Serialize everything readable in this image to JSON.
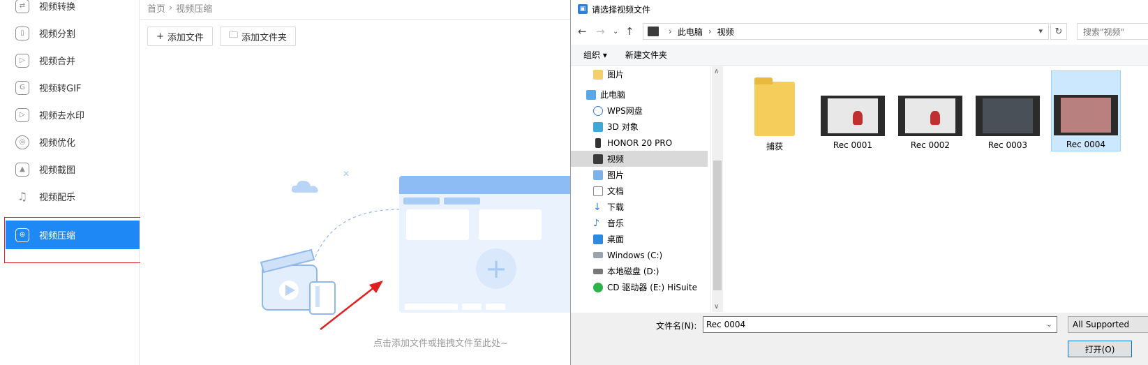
{
  "sidebar": {
    "items": [
      {
        "label": "视频转换",
        "icon": "convert-icon"
      },
      {
        "label": "视频分割",
        "icon": "split-icon"
      },
      {
        "label": "视频合并",
        "icon": "merge-icon"
      },
      {
        "label": "视频转GIF",
        "icon": "gif-icon"
      },
      {
        "label": "视频去水印",
        "icon": "watermark-icon"
      },
      {
        "label": "视频优化",
        "icon": "optimize-icon"
      },
      {
        "label": "视频截图",
        "icon": "screenshot-icon"
      },
      {
        "label": "视频配乐",
        "icon": "music-icon"
      },
      {
        "label": "视频压缩",
        "icon": "compress-icon"
      }
    ],
    "active_index": 8,
    "active_color": "#1e88f5"
  },
  "main": {
    "breadcrumb": {
      "home": "首页",
      "sep": "›",
      "current": "视频压缩"
    },
    "add_file_label": "添加文件",
    "add_folder_label": "添加文件夹",
    "hint": "点击添加文件或拖拽文件至此处~"
  },
  "dialog": {
    "title": "请选择视频文件",
    "address": {
      "root": "此电脑",
      "folder": "视频",
      "sep": "›"
    },
    "search_placeholder": "搜索\"视频\"",
    "toolbar": {
      "organize": "组织 ▾",
      "new_folder": "新建文件夹"
    },
    "tree": [
      {
        "label": "图片",
        "icon": "pictures-icon",
        "indent": 1
      },
      {
        "label": "此电脑",
        "icon": "this-pc-icon",
        "indent": 0
      },
      {
        "label": "WPS网盘",
        "icon": "cloud-drive-icon",
        "indent": 1
      },
      {
        "label": "3D 对象",
        "icon": "3d-objects-icon",
        "indent": 1
      },
      {
        "label": "HONOR 20 PRO",
        "icon": "phone-icon",
        "indent": 1
      },
      {
        "label": "视频",
        "icon": "videos-icon",
        "indent": 1,
        "selected": true
      },
      {
        "label": "图片",
        "icon": "pictures-icon",
        "indent": 1
      },
      {
        "label": "文档",
        "icon": "documents-icon",
        "indent": 1
      },
      {
        "label": "下载",
        "icon": "downloads-icon",
        "indent": 1
      },
      {
        "label": "音乐",
        "icon": "music-note-icon",
        "indent": 1
      },
      {
        "label": "桌面",
        "icon": "desktop-icon",
        "indent": 1
      },
      {
        "label": "Windows (C:)",
        "icon": "windows-drive-icon",
        "indent": 1
      },
      {
        "label": "本地磁盘 (D:)",
        "icon": "disk-drive-icon",
        "indent": 1
      },
      {
        "label": "CD 驱动器 (E:) HiSuite",
        "icon": "cd-drive-icon",
        "indent": 1
      }
    ],
    "files": [
      {
        "label": "捕获",
        "kind": "folder"
      },
      {
        "label": "Rec 0001",
        "kind": "video"
      },
      {
        "label": "Rec 0002",
        "kind": "video"
      },
      {
        "label": "Rec 0003",
        "kind": "video"
      },
      {
        "label": "Rec 0004",
        "kind": "video",
        "selected": true
      }
    ],
    "filename_label": "文件名(N):",
    "filename_value": "Rec 0004",
    "filetype_value": "All Supported",
    "open_label": "打开(O)"
  },
  "colors": {
    "annotation_red": "#e0201e",
    "selection_blue": "#cce8ff"
  }
}
